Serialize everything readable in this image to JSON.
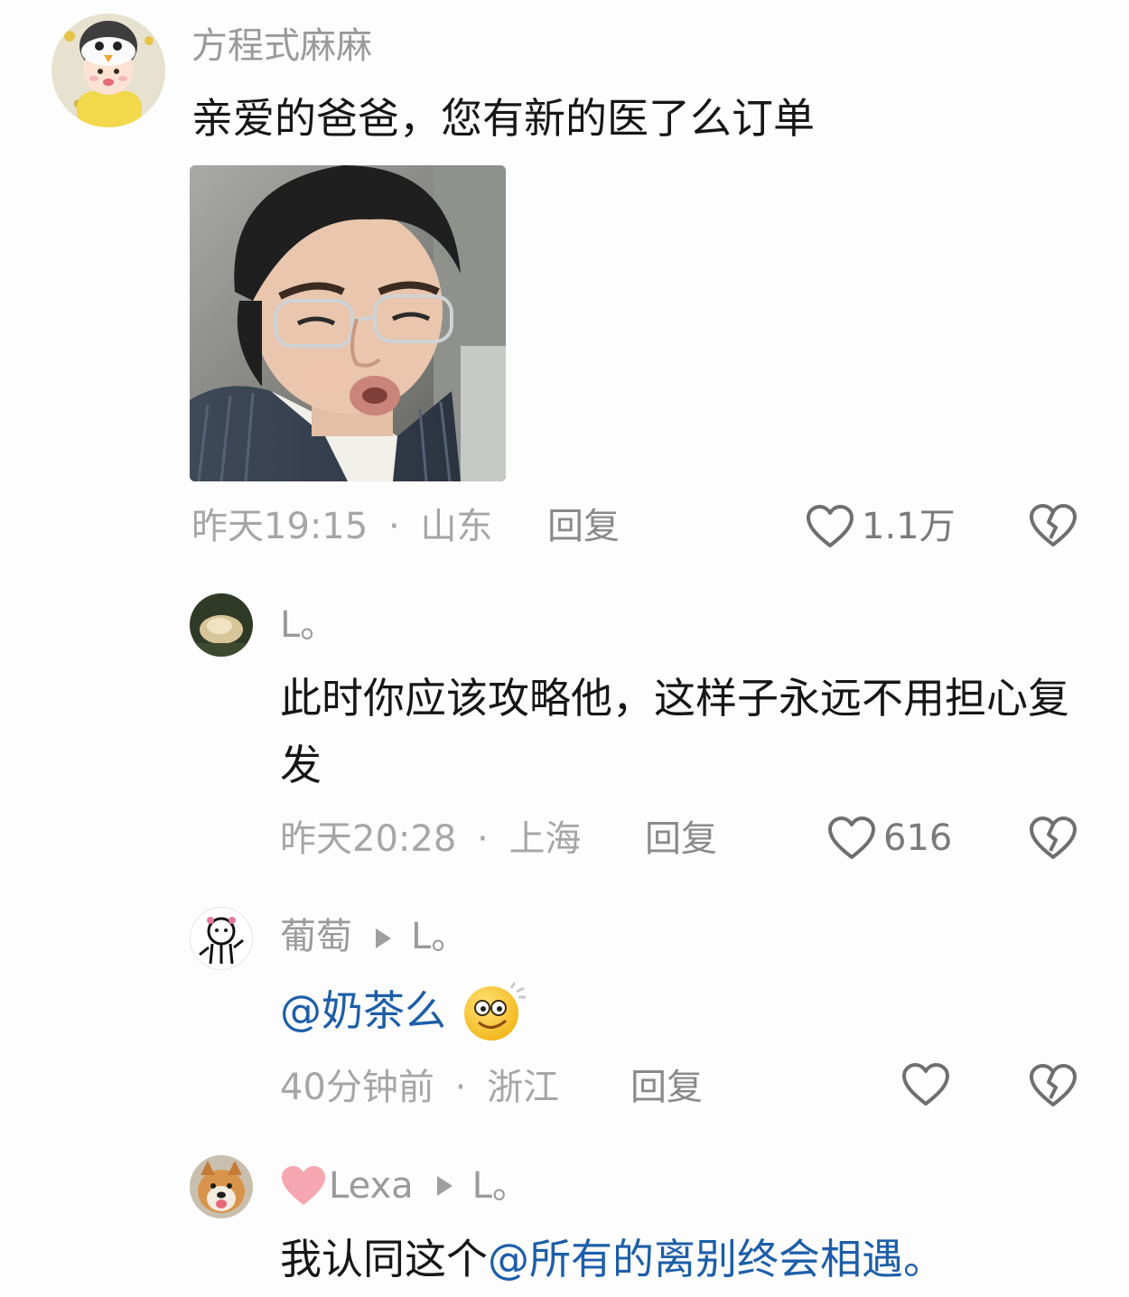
{
  "comments": [
    {
      "username": "方程式麻麻",
      "text": "亲爱的爸爸，您有新的医了么订单",
      "time": "昨天19:15",
      "location": "山东",
      "reply_label": "回复",
      "likes": "1.1万"
    },
    {
      "username": "L。",
      "text": "此时你应该攻略他，这样子永远不用担心复发",
      "time": "昨天20:28",
      "location": "上海",
      "reply_label": "回复",
      "likes": "616"
    },
    {
      "username": "葡萄",
      "reply_to": "L。",
      "mention": "@奶茶么",
      "time": "40分钟前",
      "location": "浙江",
      "reply_label": "回复",
      "likes": ""
    },
    {
      "username": "Lexa",
      "reply_to": "L。",
      "text": "我认同这个",
      "mention": "@所有的离别终会相遇。"
    }
  ],
  "separator": "·",
  "colors": {
    "mention": "#1d5ea8",
    "meta": "#a6a6a6",
    "username": "#9a9a9a",
    "text": "#161616",
    "badge_heart": "#f6a6b0"
  },
  "icons": [
    "heart-outline-icon",
    "broken-heart-icon",
    "play-arrow-icon",
    "heart-badge-icon",
    "smiley-emoji-icon"
  ]
}
